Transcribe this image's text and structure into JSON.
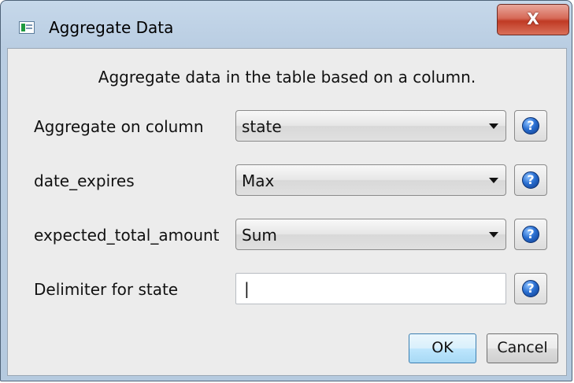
{
  "window": {
    "title": "Aggregate Data",
    "close_label": "X"
  },
  "description": "Aggregate data in the table based on a column.",
  "fields": [
    {
      "label": "Aggregate on column",
      "value": "state"
    },
    {
      "label": "date_expires",
      "value": "Max"
    },
    {
      "label": "expected_total_amount",
      "value": "Sum"
    }
  ],
  "delimiter": {
    "label": "Delimiter for state",
    "value": "|"
  },
  "buttons": {
    "ok": "OK",
    "cancel": "Cancel"
  },
  "icons": {
    "help": "help-icon",
    "help_glyph": "?"
  }
}
